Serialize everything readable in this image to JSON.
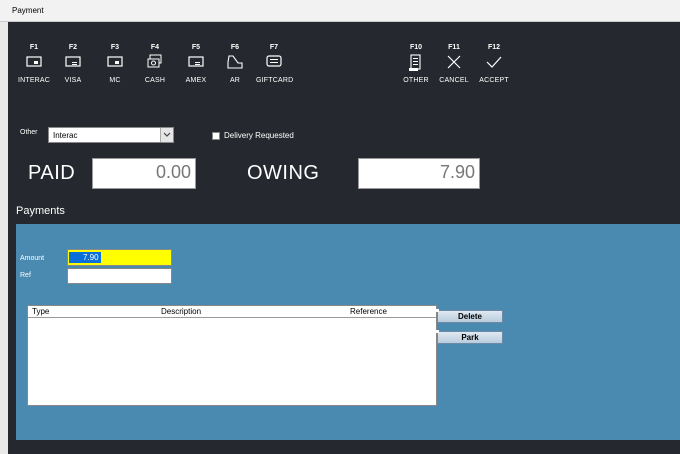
{
  "window": {
    "title": "Payment"
  },
  "function_keys": [
    {
      "key": "F1",
      "label": "INTERAC",
      "icon": "card-chip-icon"
    },
    {
      "key": "F2",
      "label": "VISA",
      "icon": "card-stripe-icon"
    },
    {
      "key": "F3",
      "label": "MC",
      "icon": "card-chip-icon"
    },
    {
      "key": "F4",
      "label": "CASH",
      "icon": "cash-icon"
    },
    {
      "key": "F5",
      "label": "AMEX",
      "icon": "card-stripe-icon"
    },
    {
      "key": "F6",
      "label": "AR",
      "icon": "account-icon"
    },
    {
      "key": "F7",
      "label": "GIFTCARD",
      "icon": "giftcard-icon"
    },
    {
      "key": "F10",
      "label": "OTHER",
      "icon": "other-payment-icon"
    },
    {
      "key": "F11",
      "label": "CANCEL",
      "icon": "x-icon"
    },
    {
      "key": "F12",
      "label": "ACCEPT",
      "icon": "check-icon"
    }
  ],
  "other": {
    "label": "Other",
    "selected": "Interac"
  },
  "delivery": {
    "label": "Delivery Requested",
    "checked": false
  },
  "totals": {
    "paid_label": "PAID",
    "paid_value": "0.00",
    "owing_label": "OWING",
    "owing_value": "7.90"
  },
  "payments": {
    "title": "Payments",
    "amount_label": "Amount",
    "amount_value": "7.90",
    "ref_label": "Ref",
    "ref_value": "",
    "columns": [
      "Type",
      "Description",
      "Reference"
    ],
    "rows": [],
    "delete_label": "Delete",
    "park_label": "Park"
  },
  "colors": {
    "background": "#25282e",
    "panel": "#4a8ab0",
    "amount_highlight": "#ffff00"
  }
}
